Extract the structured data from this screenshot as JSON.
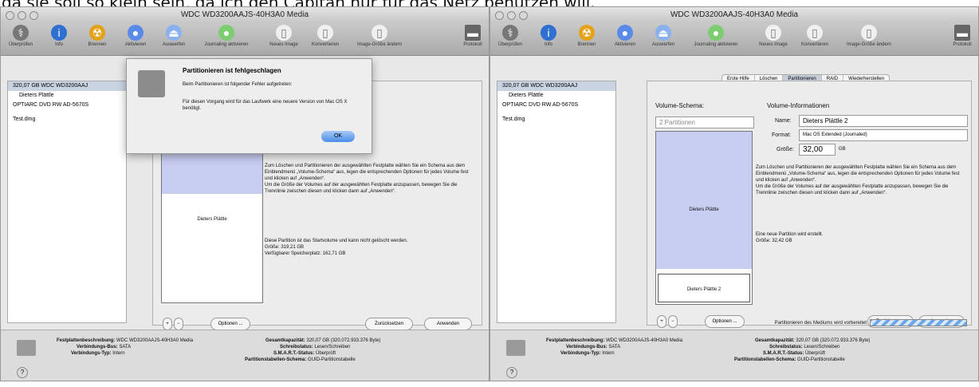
{
  "top_text": "da sie soll so klein sein, da ich den Capitan nur für das Netz benutzen will.",
  "window_title": "WDC WD3200AAJS-40H3A0 Media",
  "toolbar_items": [
    "Überprüfen",
    "Info",
    "Brennen",
    "Aktivieren",
    "Auswerfen",
    "Journaling aktivieren",
    "Neues Image",
    "Konvertieren",
    "Image-Größe ändern"
  ],
  "toolbar_right": "Protokoll",
  "sidebar": [
    "320,07 GB WDC WD3200AAJ",
    "Dieters Plättle",
    "OPTIARC DVD RW AD-5670S",
    "Test.dmg"
  ],
  "tabs": [
    "Erste Hilfe",
    "Löschen",
    "Partitionieren",
    "RAID",
    "Wiederherstellen"
  ],
  "volume_schema_label": "Volume-Schema:",
  "volume_schema_value": "2 Partitionen",
  "volume_info_label": "Volume-Informationen",
  "name_label": "Name:",
  "name_value": "Dieters Plättle 2",
  "format_label": "Format:",
  "format_value": "Mac OS Extended (Journaled)",
  "size_label": "Größe:",
  "size_value": "32,00",
  "size_unit": "GB",
  "partition_top": "Dieters Plättle",
  "partition_bottom": "Dieters Plättle 2",
  "description": "Zum Löschen und Partitionieren der ausgewählten Festplatte wählen Sie ein Schema aus dem Einblendmenü „Volume-Schema“ aus, legen die entsprechenden Optionen für jedes Volume fest und klicken auf „Anwenden“.\nUm die Größe der Volumes auf der ausgewählten Festplatte anzupassen, bewegen Sie die Trennlinie zwischen diesen und klicken dann auf „Anwenden“.",
  "left_note": "Diese Partition ist das Startvolume und kann nicht gelöscht werden.\nGröße: 319,21 GB\nVerfügbarer Speicherplatz: 162,71 GB",
  "right_note": "Eine neue Partition wird erstellt.\nGröße: 32,42 GB",
  "options_button": "Optionen ...",
  "revert_button": "Zurücksetzen",
  "apply_button": "Anwenden",
  "progress_label": "Partitionieren des Mediums wird vorbereitet",
  "status": {
    "desc_label": "Festplattenbeschreibung:",
    "desc_value": "WDC WD3200AAJS-40H3A0 Media",
    "bus_label": "Verbindungs-Bus:",
    "bus_value": "SATA",
    "type_label": "Verbindungs-Typ:",
    "type_value": "Intern",
    "capacity_label": "Gesamtkapazität:",
    "capacity_value": "320,07 GB (320.072.933.376 Byte)",
    "write_label": "Schreibstatus:",
    "write_value": "Lesen/Schreiben",
    "smart_label": "S.M.A.R.T.-Status:",
    "smart_value": "Überprüft",
    "scheme_label": "Partitionstabellen-Schema:",
    "scheme_value": "GUID-Partitionstabelle"
  },
  "dialog": {
    "title": "Partitionieren ist fehlgeschlagen",
    "line1": "Beim Partitionieren ist folgender Fehler aufgetreten:",
    "line2": "Für diesen Vorgang wird für das Laufwerk eine neuere Version von Mac OS X benötigt.",
    "ok": "OK"
  },
  "colors": {
    "blue_partition": "#c8cdf2",
    "selection": "#c9d3e2",
    "ok_button": "#4b8ee8"
  }
}
